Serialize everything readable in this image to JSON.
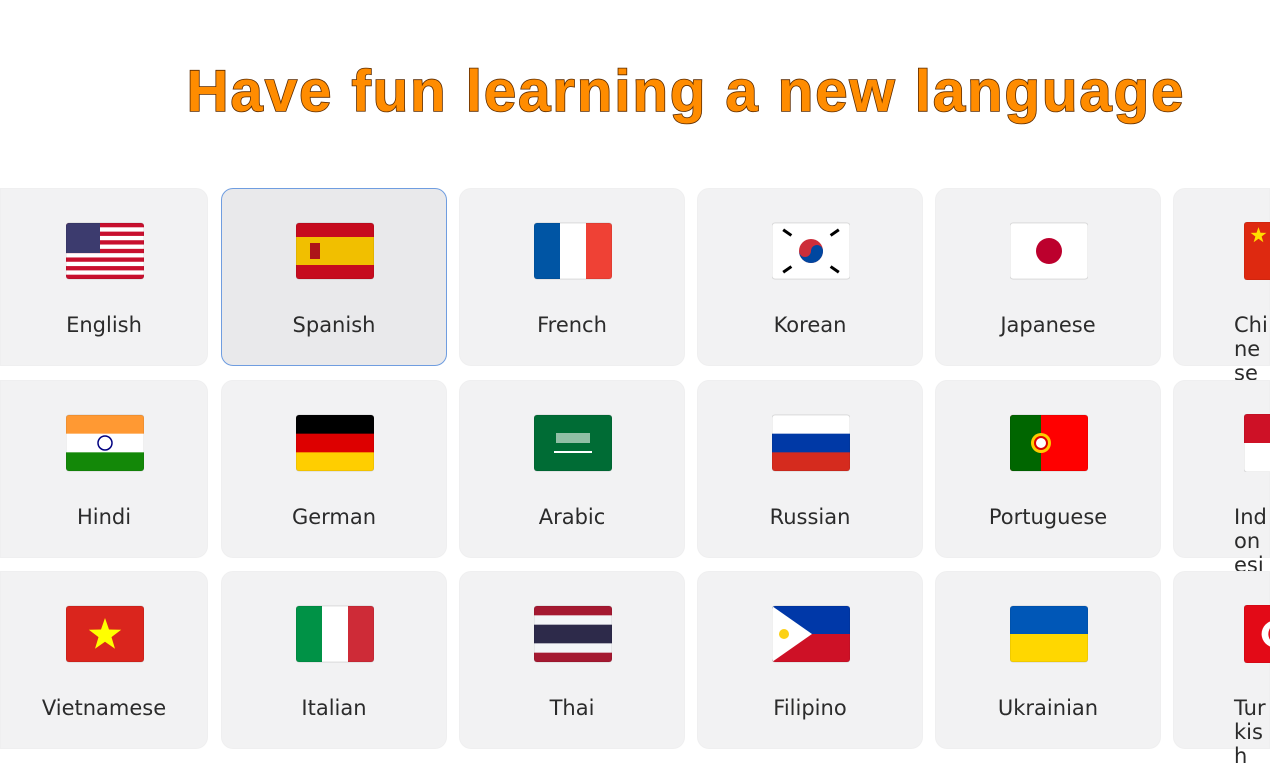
{
  "title": "Have fun learning a new language",
  "colors": {
    "title": "#ff8c00",
    "selected_border": "#6f9de0",
    "card_bg": "#f2f2f3"
  },
  "selected": "Spanish",
  "languages": [
    [
      {
        "label": "English",
        "flag": "flag-us"
      },
      {
        "label": "Spanish",
        "flag": "flag-es"
      },
      {
        "label": "French",
        "flag": "flag-fr"
      },
      {
        "label": "Korean",
        "flag": "flag-kr"
      },
      {
        "label": "Japanese",
        "flag": "flag-jp"
      },
      {
        "label": "Chinese",
        "flag": "flag-cn"
      }
    ],
    [
      {
        "label": "Hindi",
        "flag": "flag-in"
      },
      {
        "label": "German",
        "flag": "flag-de"
      },
      {
        "label": "Arabic",
        "flag": "flag-sa"
      },
      {
        "label": "Russian",
        "flag": "flag-ru"
      },
      {
        "label": "Portuguese",
        "flag": "flag-pt"
      },
      {
        "label": "Indonesian",
        "flag": "flag-id"
      }
    ],
    [
      {
        "label": "Vietnamese",
        "flag": "flag-vn"
      },
      {
        "label": "Italian",
        "flag": "flag-it"
      },
      {
        "label": "Thai",
        "flag": "flag-th"
      },
      {
        "label": "Filipino",
        "flag": "flag-ph"
      },
      {
        "label": "Ukrainian",
        "flag": "flag-ua"
      },
      {
        "label": "Turkish",
        "flag": "flag-tr"
      }
    ]
  ]
}
